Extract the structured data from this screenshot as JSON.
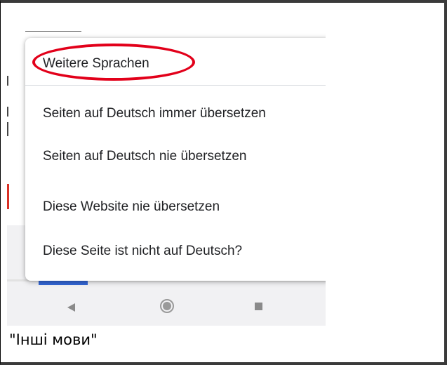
{
  "menu": {
    "items": [
      {
        "label": "Weitere Sprachen"
      },
      {
        "label": "Seiten auf Deutsch immer übersetzen"
      },
      {
        "label": "Seiten auf Deutsch nie übersetzen"
      },
      {
        "label": "Diese Website nie übersetzen"
      },
      {
        "label": "Diese Seite ist nicht auf Deutsch?"
      }
    ]
  },
  "highlight": {
    "color": "#e2001a",
    "target": "Weitere Sprachen"
  },
  "navbar": {
    "icons": [
      "back-icon",
      "home-icon",
      "recents-icon"
    ]
  },
  "caption": {
    "text": "\"Інші мови\""
  }
}
